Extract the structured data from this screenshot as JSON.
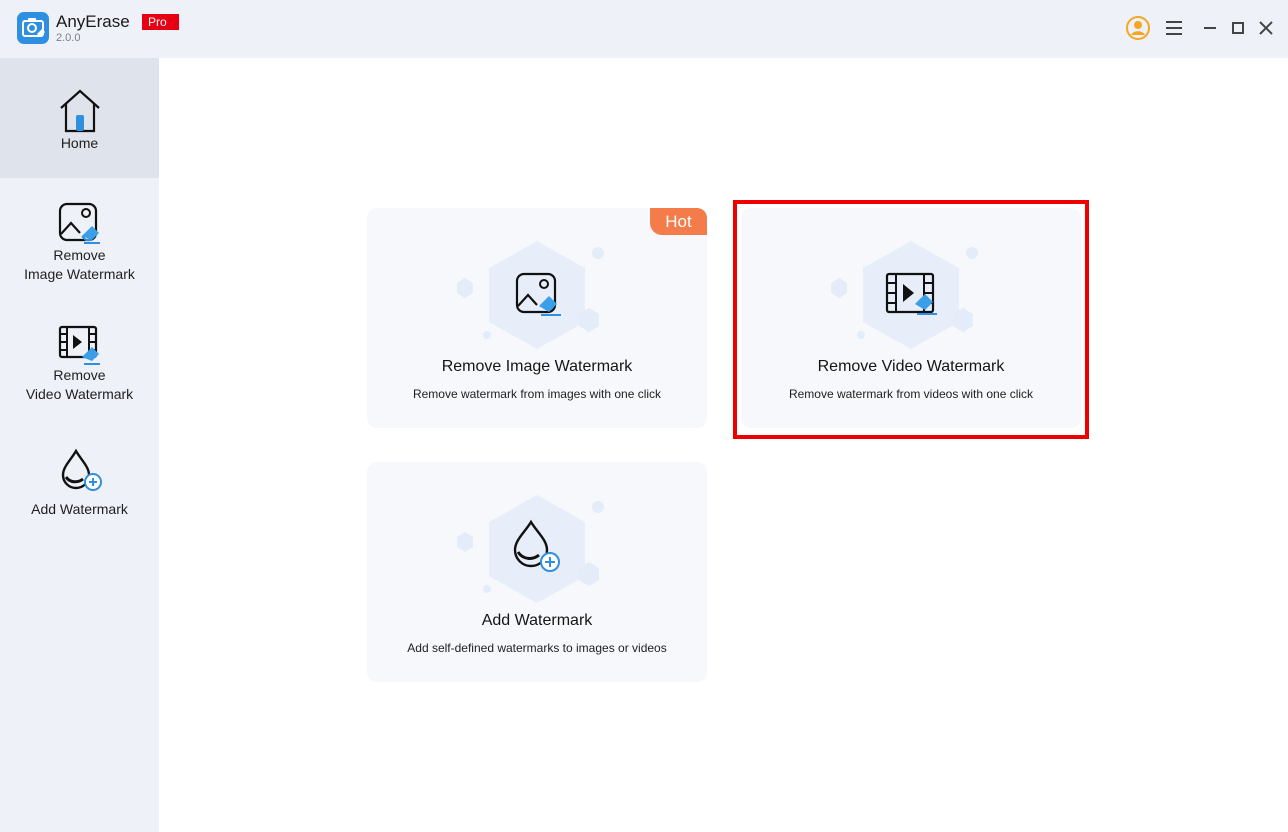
{
  "app": {
    "name": "AnyErase",
    "version": "2.0.0",
    "badge": "Pro"
  },
  "colors": {
    "accent": "#2f8fe0",
    "pro_badge": "#e60012",
    "hot_badge": "#f47b4a",
    "highlight": "#ee0000",
    "user_icon": "#f5a623"
  },
  "window_controls": [
    "user-icon",
    "menu-icon",
    "minimize-icon",
    "maximize-icon",
    "close-icon"
  ],
  "sidebar": {
    "items": [
      {
        "label_lines": [
          "Home"
        ],
        "icon": "home-icon",
        "active": true
      },
      {
        "label_lines": [
          "Remove",
          "Image Watermark"
        ],
        "icon": "image-eraser-icon",
        "active": false
      },
      {
        "label_lines": [
          "Remove",
          "Video Watermark"
        ],
        "icon": "video-eraser-icon",
        "active": false
      },
      {
        "label_lines": [
          "Add Watermark"
        ],
        "icon": "drop-add-icon",
        "active": false
      }
    ]
  },
  "cards": [
    {
      "title": "Remove Image Watermark",
      "desc": "Remove watermark from images with one click",
      "icon": "image-eraser-icon",
      "badge": "Hot"
    },
    {
      "title": "Remove Video Watermark",
      "desc": "Remove watermark from videos with one click",
      "icon": "video-eraser-icon",
      "highlighted": true
    },
    {
      "title": "Add Watermark",
      "desc": "Add self-defined watermarks to images or videos",
      "icon": "drop-add-icon"
    }
  ]
}
